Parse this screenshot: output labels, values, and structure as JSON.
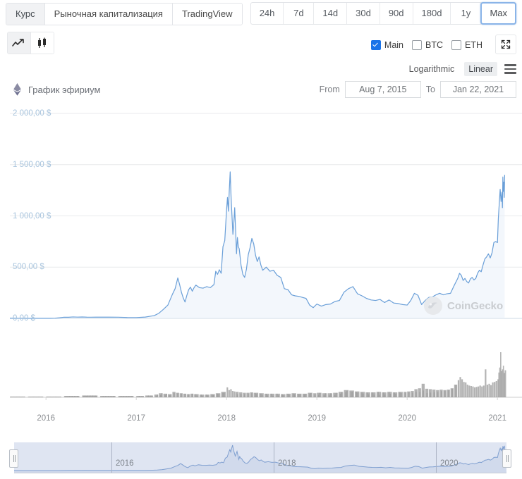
{
  "tabs": [
    {
      "label": "Курс",
      "active": true
    },
    {
      "label": "Рыночная капитализация",
      "active": false
    },
    {
      "label": "TradingView",
      "active": false
    }
  ],
  "ranges": [
    {
      "label": "24h",
      "selected": false
    },
    {
      "label": "7d",
      "selected": false
    },
    {
      "label": "14d",
      "selected": false
    },
    {
      "label": "30d",
      "selected": false
    },
    {
      "label": "90d",
      "selected": false
    },
    {
      "label": "180d",
      "selected": false
    },
    {
      "label": "1y",
      "selected": false
    },
    {
      "label": "Max",
      "selected": true
    }
  ],
  "chart_type_buttons": [
    {
      "icon": "line-chart-icon",
      "active": true
    },
    {
      "icon": "candlestick-chart-icon",
      "active": false
    }
  ],
  "series_toggles": [
    {
      "label": "Main",
      "checked": true
    },
    {
      "label": "BTC",
      "checked": false
    },
    {
      "label": "ETH",
      "checked": false
    }
  ],
  "expand_icon": "fullscreen-icon",
  "scale": {
    "logarithmic_label": "Logarithmic",
    "linear_label": "Linear",
    "selected": "Linear",
    "menu_icon": "hamburger-menu-icon"
  },
  "chart_header": {
    "coin_icon": "ethereum-icon",
    "title": "График эфириум"
  },
  "date_range": {
    "from_label": "From",
    "from_value": "Aug 7, 2015",
    "to_label": "To",
    "to_value": "Jan 22, 2021"
  },
  "watermark": {
    "text": "CoinGecko",
    "icon": "coingecko-logo-icon"
  },
  "colors": {
    "line": "#6a9fd8",
    "line_fill": "#eaf1f9",
    "volume": "#9a9a9a",
    "accent": "#1a73e8",
    "selected_range_border": "#8ab4e8",
    "axis_label": "#a8c4dd",
    "grid": "#e8eaec",
    "navigator_bg": "#dfe5f2"
  },
  "navigator": {
    "ticks": [
      "2016",
      "2018",
      "2020"
    ],
    "handle_left": "range-handle-left",
    "handle_right": "range-handle-right"
  },
  "chart_data": {
    "type": "line",
    "title": "График эфириум",
    "xlabel": "",
    "ylabel": "",
    "currency": "$",
    "ylim": [
      0,
      2000
    ],
    "ytick_labels": [
      "2 000,00 $",
      "1 500,00 $",
      "1 000,00 $",
      "500,00 $",
      "0,00 $"
    ],
    "ytick_values": [
      2000,
      1500,
      1000,
      500,
      0
    ],
    "xtick_labels": [
      "2016",
      "2017",
      "2018",
      "2019",
      "2020",
      "2021"
    ],
    "xtick_values": [
      2016,
      2017,
      2018,
      2019,
      2020,
      2021
    ],
    "xlim": [
      2015.6,
      2021.1
    ],
    "grid": true,
    "legend": "none",
    "series": [
      {
        "name": "Main (ETH price USD)",
        "color": "#6a9fd8",
        "points": [
          [
            2015.6,
            2.8
          ],
          [
            2015.7,
            1.2
          ],
          [
            2015.8,
            0.9
          ],
          [
            2015.9,
            1.0
          ],
          [
            2016.0,
            0.95
          ],
          [
            2016.05,
            1.1
          ],
          [
            2016.1,
            2.0
          ],
          [
            2016.15,
            6.0
          ],
          [
            2016.2,
            11.5
          ],
          [
            2016.25,
            11.0
          ],
          [
            2016.3,
            14.0
          ],
          [
            2016.35,
            12.5
          ],
          [
            2016.4,
            13.8
          ],
          [
            2016.45,
            12.0
          ],
          [
            2016.5,
            11.5
          ],
          [
            2016.55,
            12.2
          ],
          [
            2016.6,
            11.8
          ],
          [
            2016.7,
            12.0
          ],
          [
            2016.8,
            11.5
          ],
          [
            2016.9,
            8.5
          ],
          [
            2017.0,
            8.2
          ],
          [
            2017.05,
            10.5
          ],
          [
            2017.1,
            13.0
          ],
          [
            2017.15,
            20.0
          ],
          [
            2017.2,
            28.0
          ],
          [
            2017.25,
            50.0
          ],
          [
            2017.3,
            88.0
          ],
          [
            2017.35,
            130.0
          ],
          [
            2017.4,
            235.0
          ],
          [
            2017.43,
            290.0
          ],
          [
            2017.46,
            395.0
          ],
          [
            2017.48,
            330.0
          ],
          [
            2017.5,
            255.0
          ],
          [
            2017.52,
            200.0
          ],
          [
            2017.54,
            160.0
          ],
          [
            2017.56,
            225.0
          ],
          [
            2017.58,
            280.0
          ],
          [
            2017.6,
            305.0
          ],
          [
            2017.62,
            265.0
          ],
          [
            2017.64,
            300.0
          ],
          [
            2017.66,
            325.0
          ],
          [
            2017.7,
            300.0
          ],
          [
            2017.74,
            295.0
          ],
          [
            2017.78,
            310.0
          ],
          [
            2017.82,
            300.0
          ],
          [
            2017.86,
            330.0
          ],
          [
            2017.88,
            460.0
          ],
          [
            2017.9,
            430.0
          ],
          [
            2017.92,
            475.0
          ],
          [
            2017.94,
            440.0
          ],
          [
            2017.96,
            700.0
          ],
          [
            2017.98,
            760.0
          ],
          [
            2018.0,
            1060.0
          ],
          [
            2018.01,
            1180.0
          ],
          [
            2018.02,
            1045.0
          ],
          [
            2018.03,
            1250.0
          ],
          [
            2018.04,
            1430.0
          ],
          [
            2018.05,
            1180.0
          ],
          [
            2018.06,
            1000.0
          ],
          [
            2018.07,
            820.0
          ],
          [
            2018.08,
            930.0
          ],
          [
            2018.09,
            1080.0
          ],
          [
            2018.1,
            860.0
          ],
          [
            2018.11,
            630.0
          ],
          [
            2018.12,
            790.0
          ],
          [
            2018.13,
            700.0
          ],
          [
            2018.14,
            680.0
          ],
          [
            2018.16,
            520.0
          ],
          [
            2018.18,
            430.0
          ],
          [
            2018.2,
            400.0
          ],
          [
            2018.22,
            480.0
          ],
          [
            2018.24,
            620.0
          ],
          [
            2018.26,
            690.0
          ],
          [
            2018.28,
            780.0
          ],
          [
            2018.3,
            730.0
          ],
          [
            2018.32,
            620.0
          ],
          [
            2018.34,
            555.0
          ],
          [
            2018.36,
            600.0
          ],
          [
            2018.38,
            520.0
          ],
          [
            2018.4,
            470.0
          ],
          [
            2018.44,
            500.0
          ],
          [
            2018.48,
            460.0
          ],
          [
            2018.52,
            470.0
          ],
          [
            2018.56,
            420.0
          ],
          [
            2018.6,
            400.0
          ],
          [
            2018.64,
            290.0
          ],
          [
            2018.68,
            280.0
          ],
          [
            2018.72,
            230.0
          ],
          [
            2018.76,
            220.0
          ],
          [
            2018.8,
            215.0
          ],
          [
            2018.84,
            205.0
          ],
          [
            2018.88,
            195.0
          ],
          [
            2018.92,
            130.0
          ],
          [
            2018.96,
            105.0
          ],
          [
            2019.0,
            140.0
          ],
          [
            2019.05,
            120.0
          ],
          [
            2019.1,
            135.0
          ],
          [
            2019.15,
            140.0
          ],
          [
            2019.2,
            165.0
          ],
          [
            2019.25,
            175.0
          ],
          [
            2019.3,
            255.0
          ],
          [
            2019.35,
            290.0
          ],
          [
            2019.4,
            310.0
          ],
          [
            2019.45,
            240.0
          ],
          [
            2019.5,
            220.0
          ],
          [
            2019.55,
            195.0
          ],
          [
            2019.6,
            180.0
          ],
          [
            2019.65,
            175.0
          ],
          [
            2019.7,
            185.0
          ],
          [
            2019.75,
            155.0
          ],
          [
            2019.8,
            180.0
          ],
          [
            2019.85,
            150.0
          ],
          [
            2019.9,
            145.0
          ],
          [
            2019.95,
            135.0
          ],
          [
            2020.0,
            130.0
          ],
          [
            2020.04,
            175.0
          ],
          [
            2020.08,
            245.0
          ],
          [
            2020.12,
            225.0
          ],
          [
            2020.16,
            135.0
          ],
          [
            2020.2,
            175.0
          ],
          [
            2020.24,
            205.0
          ],
          [
            2020.28,
            210.0
          ],
          [
            2020.32,
            230.0
          ],
          [
            2020.36,
            245.0
          ],
          [
            2020.4,
            230.0
          ],
          [
            2020.44,
            240.0
          ],
          [
            2020.48,
            245.0
          ],
          [
            2020.52,
            320.0
          ],
          [
            2020.56,
            390.0
          ],
          [
            2020.58,
            440.0
          ],
          [
            2020.6,
            420.0
          ],
          [
            2020.62,
            370.0
          ],
          [
            2020.64,
            390.0
          ],
          [
            2020.66,
            360.0
          ],
          [
            2020.68,
            345.0
          ],
          [
            2020.7,
            385.0
          ],
          [
            2020.72,
            400.0
          ],
          [
            2020.74,
            375.0
          ],
          [
            2020.76,
            390.0
          ],
          [
            2020.78,
            440.0
          ],
          [
            2020.8,
            470.0
          ],
          [
            2020.82,
            455.0
          ],
          [
            2020.84,
            520.0
          ],
          [
            2020.86,
            580.0
          ],
          [
            2020.88,
            600.0
          ],
          [
            2020.9,
            630.0
          ],
          [
            2020.92,
            590.0
          ],
          [
            2020.94,
            640.0
          ],
          [
            2020.96,
            740.0
          ],
          [
            2020.98,
            750.0
          ],
          [
            2021.0,
            740.0
          ],
          [
            2021.01,
            980.0
          ],
          [
            2021.02,
            1120.0
          ],
          [
            2021.03,
            1260.0
          ],
          [
            2021.04,
            1140.0
          ],
          [
            2021.05,
            1230.0
          ],
          [
            2021.055,
            1080.0
          ],
          [
            2021.06,
            1380.0
          ],
          [
            2021.065,
            1240.0
          ],
          [
            2021.07,
            1330.0
          ],
          [
            2021.075,
            1180.0
          ],
          [
            2021.08,
            1400.0
          ]
        ]
      }
    ],
    "volume_series": {
      "name": "Volume",
      "color": "#9a9a9a",
      "points": [
        [
          2015.6,
          1
        ],
        [
          2015.8,
          1
        ],
        [
          2016.0,
          1
        ],
        [
          2016.2,
          3
        ],
        [
          2016.4,
          4
        ],
        [
          2016.6,
          3
        ],
        [
          2016.8,
          3
        ],
        [
          2017.0,
          3
        ],
        [
          2017.1,
          4
        ],
        [
          2017.2,
          6
        ],
        [
          2017.25,
          9
        ],
        [
          2017.3,
          8
        ],
        [
          2017.35,
          7
        ],
        [
          2017.4,
          12
        ],
        [
          2017.44,
          10
        ],
        [
          2017.48,
          9
        ],
        [
          2017.52,
          8
        ],
        [
          2017.56,
          7
        ],
        [
          2017.6,
          8
        ],
        [
          2017.64,
          7
        ],
        [
          2017.7,
          6
        ],
        [
          2017.76,
          6
        ],
        [
          2017.82,
          7
        ],
        [
          2017.88,
          9
        ],
        [
          2017.94,
          12
        ],
        [
          2018.0,
          22
        ],
        [
          2018.02,
          16
        ],
        [
          2018.04,
          18
        ],
        [
          2018.06,
          14
        ],
        [
          2018.08,
          13
        ],
        [
          2018.1,
          12
        ],
        [
          2018.14,
          11
        ],
        [
          2018.18,
          10
        ],
        [
          2018.22,
          10
        ],
        [
          2018.26,
          11
        ],
        [
          2018.3,
          10
        ],
        [
          2018.36,
          9
        ],
        [
          2018.42,
          8
        ],
        [
          2018.48,
          8
        ],
        [
          2018.54,
          8
        ],
        [
          2018.6,
          7
        ],
        [
          2018.66,
          8
        ],
        [
          2018.72,
          9
        ],
        [
          2018.78,
          8
        ],
        [
          2018.84,
          8
        ],
        [
          2018.9,
          10
        ],
        [
          2018.96,
          9
        ],
        [
          2019.0,
          10
        ],
        [
          2019.06,
          9
        ],
        [
          2019.12,
          9
        ],
        [
          2019.18,
          10
        ],
        [
          2019.24,
          12
        ],
        [
          2019.3,
          16
        ],
        [
          2019.36,
          15
        ],
        [
          2019.42,
          13
        ],
        [
          2019.48,
          12
        ],
        [
          2019.54,
          11
        ],
        [
          2019.6,
          11
        ],
        [
          2019.66,
          12
        ],
        [
          2019.72,
          11
        ],
        [
          2019.78,
          12
        ],
        [
          2019.84,
          11
        ],
        [
          2019.9,
          12
        ],
        [
          2019.96,
          12
        ],
        [
          2020.0,
          13
        ],
        [
          2020.04,
          14
        ],
        [
          2020.08,
          18
        ],
        [
          2020.12,
          20
        ],
        [
          2020.16,
          30
        ],
        [
          2020.2,
          19
        ],
        [
          2020.24,
          18
        ],
        [
          2020.28,
          17
        ],
        [
          2020.32,
          16
        ],
        [
          2020.36,
          17
        ],
        [
          2020.4,
          16
        ],
        [
          2020.44,
          17
        ],
        [
          2020.48,
          20
        ],
        [
          2020.52,
          28
        ],
        [
          2020.56,
          38
        ],
        [
          2020.58,
          45
        ],
        [
          2020.6,
          40
        ],
        [
          2020.62,
          34
        ],
        [
          2020.64,
          33
        ],
        [
          2020.66,
          28
        ],
        [
          2020.68,
          26
        ],
        [
          2020.7,
          25
        ],
        [
          2020.72,
          24
        ],
        [
          2020.74,
          22
        ],
        [
          2020.76,
          23
        ],
        [
          2020.78,
          24
        ],
        [
          2020.8,
          26
        ],
        [
          2020.82,
          24
        ],
        [
          2020.84,
          26
        ],
        [
          2020.86,
          62
        ],
        [
          2020.88,
          28
        ],
        [
          2020.9,
          30
        ],
        [
          2020.92,
          27
        ],
        [
          2020.94,
          33
        ],
        [
          2020.96,
          34
        ],
        [
          2020.98,
          36
        ],
        [
          2021.0,
          40
        ],
        [
          2021.01,
          55
        ],
        [
          2021.02,
          66
        ],
        [
          2021.03,
          100
        ],
        [
          2021.04,
          58
        ],
        [
          2021.05,
          62
        ],
        [
          2021.06,
          70
        ],
        [
          2021.07,
          54
        ],
        [
          2021.08,
          60
        ]
      ]
    },
    "navigator_overview": {
      "ticks": [
        "2016",
        "2018",
        "2020"
      ]
    }
  }
}
